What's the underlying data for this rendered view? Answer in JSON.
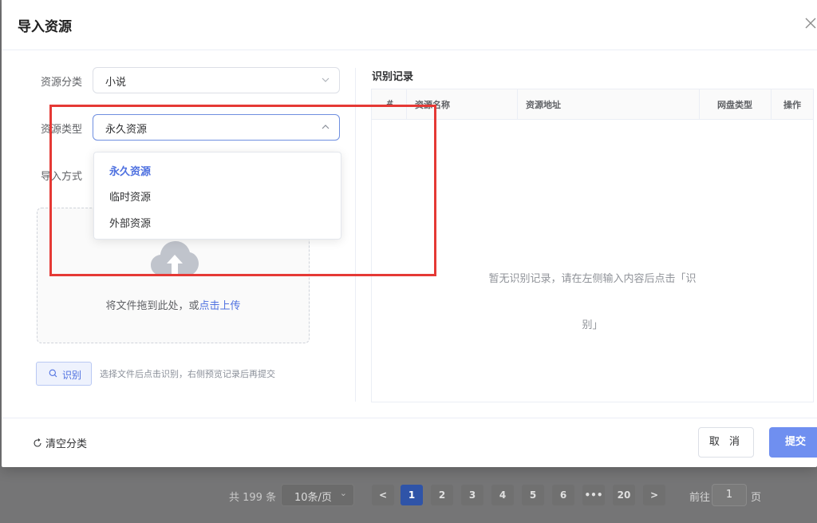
{
  "dialog": {
    "title": "导入资源",
    "close_icon": "close-icon"
  },
  "form": {
    "category_label": "资源分类",
    "category_value": "小说",
    "type_label": "资源类型",
    "type_value": "永久资源",
    "import_label": "导入方式",
    "type_options": [
      "永久资源",
      "临时资源",
      "外部资源"
    ],
    "upload_hint": "将文件拖到此处，或",
    "upload_link": "点击上传",
    "recognize_button": "识别",
    "recognize_tip": "选择文件后点击识别，右侧预览记录后再提交"
  },
  "records": {
    "title": "识别记录",
    "columns": [
      "#",
      "资源名称",
      "资源地址",
      "网盘类型",
      "操作"
    ],
    "empty_line1": "暂无识别记录，请在左侧输入内容后点击「识",
    "empty_line2": "别」"
  },
  "footer": {
    "clear_label": "清空分类",
    "cancel_label": "取 消",
    "submit_label": "提交"
  },
  "pagination": {
    "total": "共 199 条",
    "page_size": "10条/页",
    "pages": [
      "1",
      "2",
      "3",
      "4",
      "5",
      "6",
      "•••",
      "20"
    ],
    "current_page": "1",
    "goto_label": "前往",
    "goto_value": "1",
    "page_unit": "页"
  },
  "colors": {
    "accent": "#4f71e0",
    "primary_button": "#6f8ff0",
    "highlight_box": "#e53935"
  }
}
